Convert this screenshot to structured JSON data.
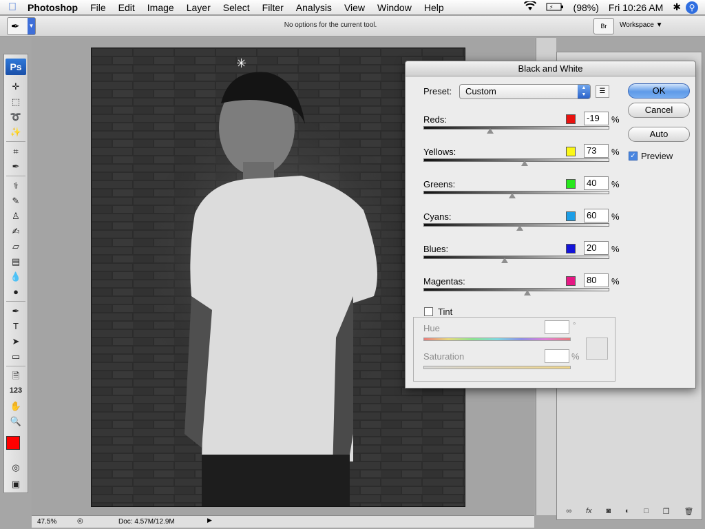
{
  "menubar": {
    "app": "Photoshop",
    "menus": [
      "File",
      "Edit",
      "Image",
      "Layer",
      "Select",
      "Filter",
      "Analysis",
      "View",
      "Window",
      "Help"
    ],
    "battery": "(98%)",
    "clock": "Fri 10:26 AM",
    "icons": [
      "apple-icon",
      "wifi-icon",
      "battery-icon",
      "bluetooth-icon",
      "spotlight-icon"
    ]
  },
  "options": {
    "message": "No options for the current tool.",
    "workspace": "Workspace"
  },
  "toolbox": {
    "logo": "Ps",
    "tools": [
      "move-tool-icon",
      "marquee-tool-icon",
      "lasso-tool-icon",
      "magic-wand-icon",
      "crop-tool-icon",
      "eyedropper-icon",
      "healing-brush-icon",
      "brush-tool-icon",
      "clone-stamp-icon",
      "history-brush-icon",
      "eraser-icon",
      "gradient-icon",
      "blur-icon",
      "dodge-icon",
      "pen-tool-icon",
      "type-tool-icon",
      "path-selection-icon",
      "shape-tool-icon",
      "notes-icon",
      "count-tool-icon",
      "hand-tool-icon",
      "zoom-tool-icon"
    ],
    "type_label": "T",
    "count_label": "123",
    "foreground_color": "#ff0000",
    "background_color": "#ffffff"
  },
  "status": {
    "zoom": "47.5%",
    "doc": "Doc: 4.57M/12.9M"
  },
  "dialog": {
    "title": "Black and White",
    "preset_label": "Preset:",
    "preset_value": "Custom",
    "ok": "OK",
    "cancel": "Cancel",
    "auto": "Auto",
    "preview_label": "Preview",
    "preview_checked": true,
    "percent": "%",
    "channels": [
      {
        "name": "Reds:",
        "value": "-19",
        "color": "#e8120f"
      },
      {
        "name": "Yellows:",
        "value": "73",
        "color": "#fbf716"
      },
      {
        "name": "Greens:",
        "value": "40",
        "color": "#27e81c"
      },
      {
        "name": "Cyans:",
        "value": "60",
        "color": "#1d9ee6"
      },
      {
        "name": "Blues:",
        "value": "20",
        "color": "#1414d9"
      },
      {
        "name": "Magentas:",
        "value": "80",
        "color": "#e51783"
      }
    ],
    "tint_label": "Tint",
    "tint_checked": false,
    "hue_label": "Hue",
    "hue_unit": "°",
    "saturation_label": "Saturation",
    "saturation_unit": "%"
  }
}
